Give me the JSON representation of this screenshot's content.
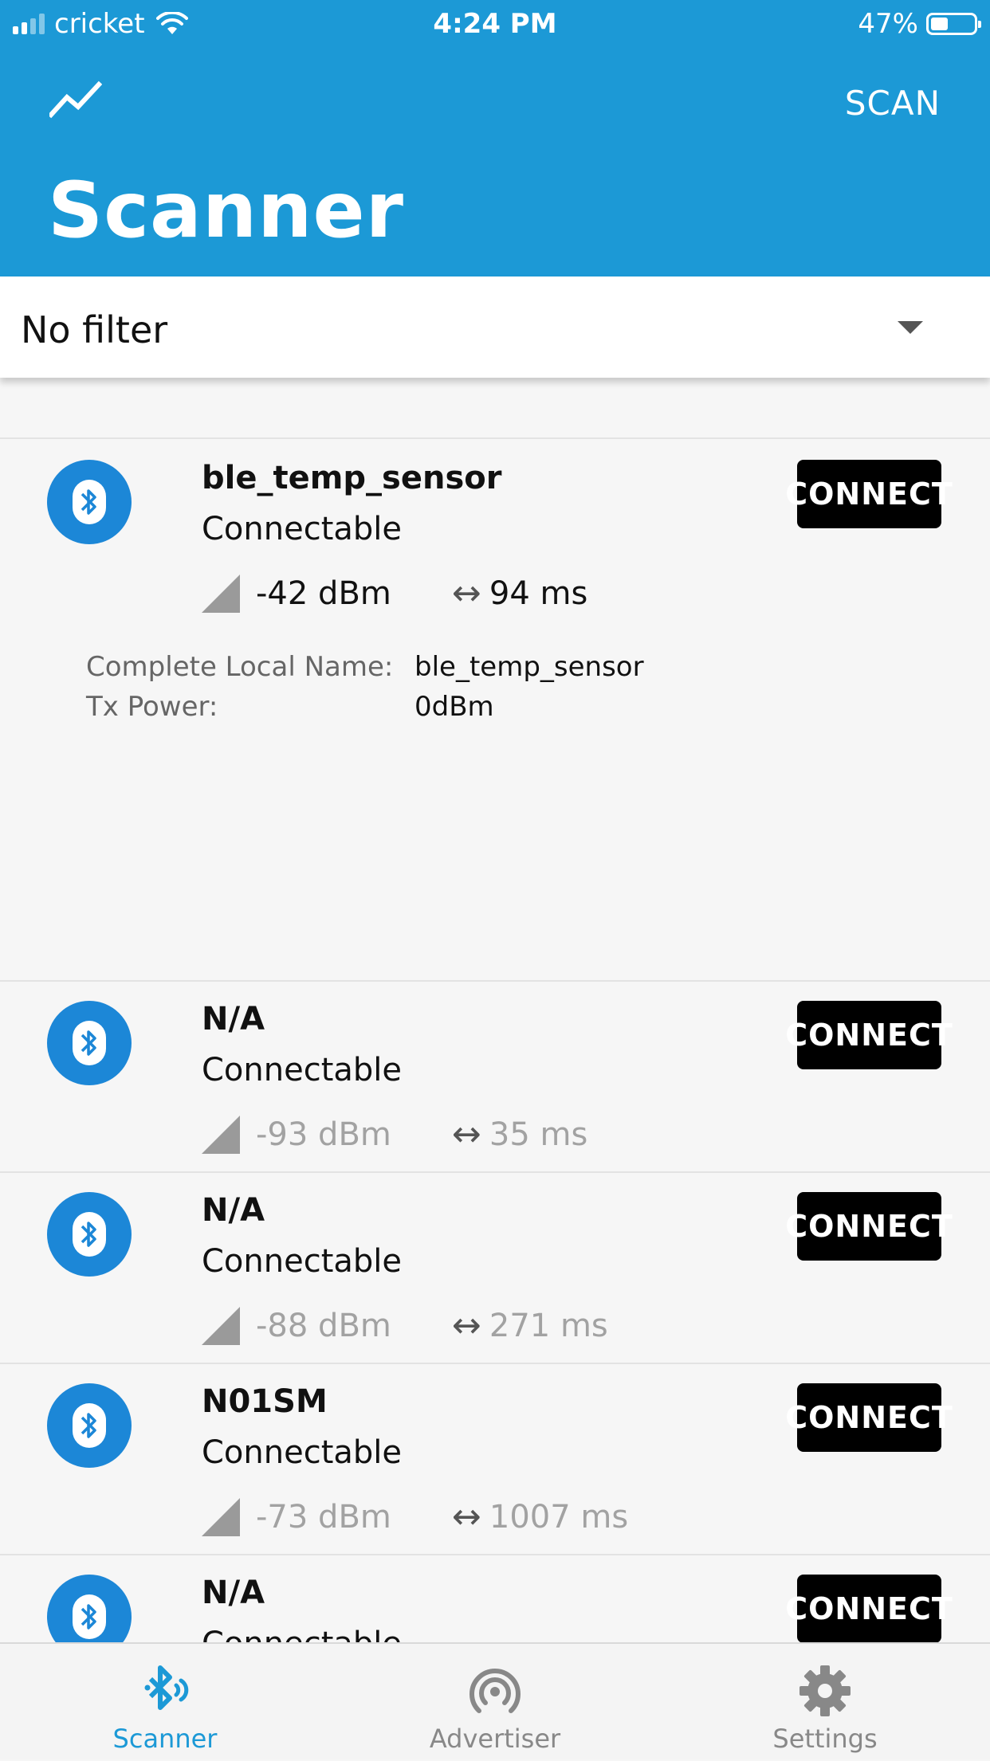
{
  "status_bar": {
    "carrier": "cricket",
    "time": "4:24 PM",
    "battery": "47%",
    "battery_level": 0.47
  },
  "header": {
    "title": "Scanner",
    "scan_label": "SCAN",
    "left_icon": "trend-line-icon"
  },
  "filter": {
    "selected": "No filter"
  },
  "devices": [
    {
      "name": "ble_temp_sensor",
      "status": "Connectable",
      "rssi": "-42 dBm",
      "interval": "94 ms",
      "connect_label": "CONNECT",
      "advertisement": [
        {
          "key": "Complete Local Name:",
          "value": "ble_temp_sensor"
        },
        {
          "key": "Tx Power:",
          "value": "0dBm"
        }
      ]
    },
    {
      "name": "N/A",
      "status": "Connectable",
      "rssi": "-93 dBm",
      "interval": "35 ms",
      "connect_label": "CONNECT"
    },
    {
      "name": "N/A",
      "status": "Connectable",
      "rssi": "-88 dBm",
      "interval": "271 ms",
      "connect_label": "CONNECT"
    },
    {
      "name": "N01SM",
      "status": "Connectable",
      "rssi": "-73 dBm",
      "interval": "1007 ms",
      "connect_label": "CONNECT"
    },
    {
      "name": "N/A",
      "status": "Connectable",
      "connect_label": "CONNECT"
    }
  ],
  "bottom_nav": [
    {
      "label": "Scanner",
      "icon": "bluetooth-scan-icon",
      "active": true
    },
    {
      "label": "Advertiser",
      "icon": "broadcast-icon",
      "active": false
    },
    {
      "label": "Settings",
      "icon": "gear-icon",
      "active": false
    }
  ],
  "colors": {
    "primary": "#1c99d6",
    "avatar": "#1c87d7",
    "button": "#000000"
  }
}
